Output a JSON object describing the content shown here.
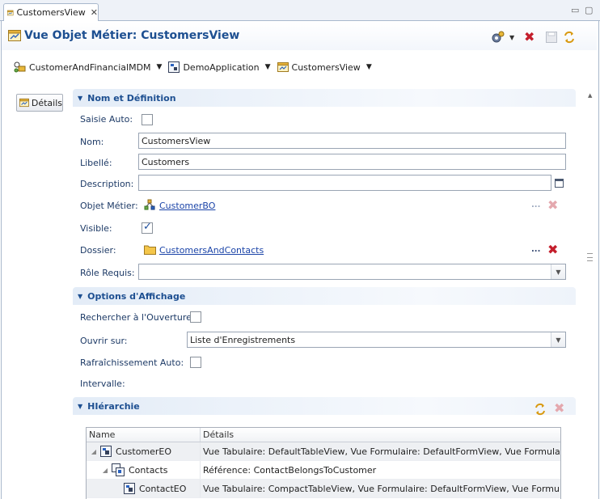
{
  "tab": {
    "label": "CustomersView",
    "close": "✕"
  },
  "window": {
    "minimize": "▭",
    "maximize": "▢"
  },
  "header": {
    "title": "Vue Objet Métier: CustomersView"
  },
  "breadcrumbs": [
    {
      "label": "CustomerAndFinancialMDM"
    },
    {
      "label": "DemoApplication"
    },
    {
      "label": "CustomersView"
    }
  ],
  "left": {
    "details_label": "Détails"
  },
  "sections": {
    "nom": "Nom et Définition",
    "options": "Options d'Affichage",
    "hierarchie": "HIérarchie"
  },
  "form": {
    "saisie_auto_label": "Saisie Auto:",
    "nom_label": "Nom:",
    "nom_value": "CustomersView",
    "libelle_label": "Libellé:",
    "libelle_value": "Customers",
    "description_label": "Description:",
    "description_value": "",
    "objet_metier_label": "Objet Métier:",
    "objet_metier_value": "CustomerBO",
    "visible_label": "Visible:",
    "dossier_label": "Dossier:",
    "dossier_value": "CustomersAndContacts",
    "role_label": "Rôle Requis:",
    "role_value": "",
    "dots": "..."
  },
  "options": {
    "rechercher_label": "Rechercher à l'Ouverture:",
    "ouvrir_label": "Ouvrir sur:",
    "ouvrir_value": "Liste d'Enregistrements",
    "rafraichissement_label": "Rafraîchissement Auto:",
    "intervalle_label": "Intervalle:"
  },
  "hierarchy": {
    "columns": [
      "Name",
      "Détails"
    ],
    "rows": [
      {
        "name": "CustomerEO",
        "details": "Vue Tabulaire: DefaultTableView, Vue Formulaire: DefaultFormView, Vue Formulaire de Sai...",
        "indent": 0
      },
      {
        "name": "Contacts",
        "details": "Référence: ContactBelongsToCustomer",
        "indent": 1
      },
      {
        "name": "ContactEO",
        "details": "Vue Tabulaire: CompactTableView, Vue Formulaire: DefaultFormView, Vue Formulaire de S...",
        "indent": 2
      }
    ]
  },
  "colors": {
    "accent": "#1d4f91",
    "delete": "#c41e2c",
    "link": "#1b44a8"
  }
}
